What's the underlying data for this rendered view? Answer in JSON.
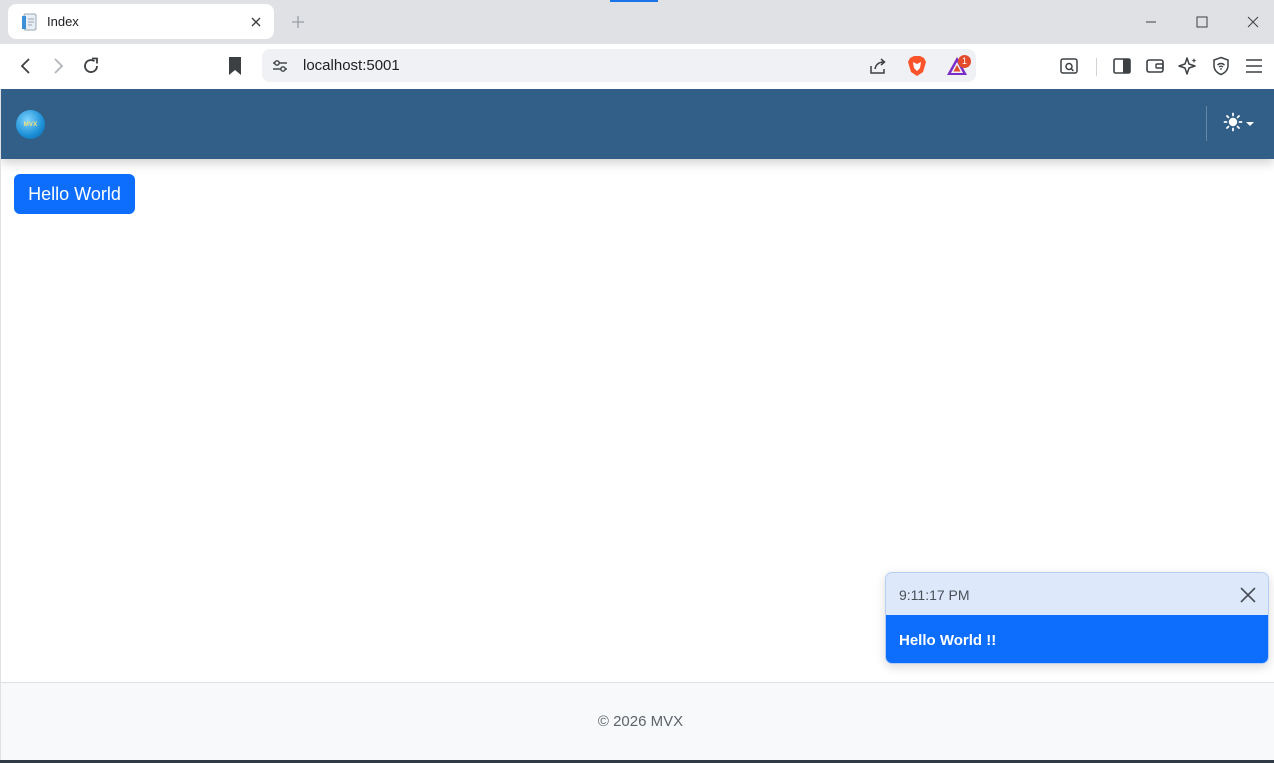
{
  "browser": {
    "tab": {
      "title": "Index"
    },
    "address": {
      "url": "localhost:5001"
    },
    "rewards_badge": "1"
  },
  "page": {
    "navbar": {
      "logo_text": "MVX"
    },
    "hello_button": {
      "label": "Hello World"
    },
    "footer": {
      "text": "© 2026 MVX"
    }
  },
  "toast": {
    "time": "9:11:17 PM",
    "message": "Hello World !!"
  },
  "colors": {
    "navbar": "#325f87",
    "primary": "#0d6efd",
    "toast_header": "#dde8fb",
    "footer_bg": "#f8f9fa"
  },
  "icons": [
    "favicon-icon",
    "close-icon",
    "plus-icon",
    "minimize-icon",
    "maximize-icon",
    "back-icon",
    "forward-icon",
    "reload-icon",
    "bookmark-icon",
    "site-settings-icon",
    "share-icon",
    "brave-shields-icon",
    "rewards-icon",
    "screenshot-icon",
    "sidebar-icon",
    "wallet-icon",
    "leo-ai-icon",
    "vpn-shield-icon",
    "menu-icon",
    "sun-icon",
    "caret-down-icon"
  ]
}
